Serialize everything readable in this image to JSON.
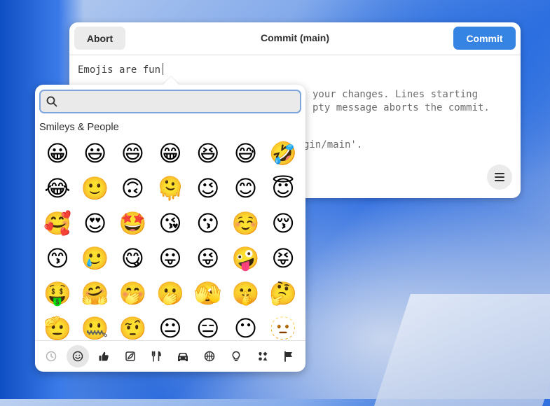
{
  "dialog": {
    "abort_label": "Abort",
    "title": "Commit (main)",
    "commit_label": "Commit",
    "commit_color": "#3584e4",
    "message_text": "Emojis are fun",
    "comment_line1": "your changes. Lines starting",
    "comment_line2": "pty message aborts the commit.",
    "comment_line3": "gin/main'.",
    "menu_icon": "hamburger-menu-icon"
  },
  "emoji_picker": {
    "search_placeholder": "",
    "search_icon": "magnifier-icon",
    "section_title": "Smileys & People",
    "emojis": [
      "😀",
      "😃",
      "😄",
      "😁",
      "😆",
      "😅",
      "🤣",
      "😂",
      "🙂",
      "🙃",
      "🫠",
      "😉",
      "😊",
      "😇",
      "🥰",
      "😍",
      "🤩",
      "😘",
      "😗",
      "☺️",
      "😚",
      "😙",
      "🥲",
      "😋",
      "😛",
      "😜",
      "🤪",
      "😝",
      "🤑",
      "🤗",
      "🤭",
      "🫢",
      "🫣",
      "🤫",
      "🤔",
      "🫡",
      "🤐",
      "🤨",
      "😐",
      "😑",
      "😶",
      "🫥"
    ],
    "categories": [
      {
        "name": "recent",
        "icon": "clock-icon",
        "active": false
      },
      {
        "name": "smileys",
        "icon": "smiley-icon",
        "active": true
      },
      {
        "name": "people",
        "icon": "thumbs-up-icon",
        "active": false
      },
      {
        "name": "nature",
        "icon": "leaf-icon",
        "active": false
      },
      {
        "name": "food",
        "icon": "fork-knife-icon",
        "active": false
      },
      {
        "name": "travel",
        "icon": "car-icon",
        "active": false
      },
      {
        "name": "activities",
        "icon": "ball-icon",
        "active": false
      },
      {
        "name": "objects",
        "icon": "lightbulb-icon",
        "active": false
      },
      {
        "name": "symbols",
        "icon": "symbols-icon",
        "active": false
      },
      {
        "name": "flags",
        "icon": "flag-icon",
        "active": false
      }
    ]
  }
}
